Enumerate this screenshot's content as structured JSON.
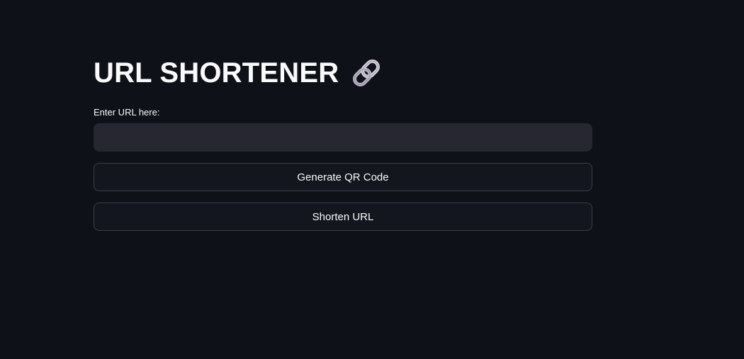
{
  "header": {
    "title": "URL SHORTENER",
    "title_icon": "link-icon"
  },
  "form": {
    "url_label": "Enter URL here:",
    "url_value": "",
    "url_placeholder": ""
  },
  "actions": {
    "generate_qr_label": "Generate QR Code",
    "shorten_label": "Shorten URL"
  },
  "colors": {
    "background": "#0e1117",
    "input_background": "#262730",
    "button_background": "#13161e",
    "button_border": "#3d3f4a",
    "text": "#fafafa"
  }
}
